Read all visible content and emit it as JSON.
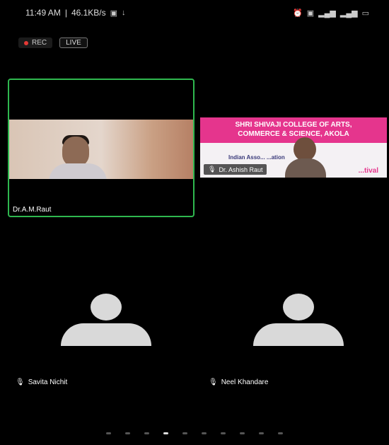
{
  "status_bar": {
    "time": "11:49 AM",
    "speed": "46.1KB/s",
    "right_icons": [
      "alarm-icon",
      "wifi-icon",
      "signal-icon",
      "signal-icon",
      "battery-icon"
    ]
  },
  "topbar": {
    "rec_label": "REC",
    "live_label": "LIVE"
  },
  "main_tile": {
    "name": "Dr.A.M.Raut"
  },
  "share_tile": {
    "banner_line1": "SHRI SHIVAJI COLLEGE OF ARTS,",
    "banner_line2": "COMMERCE & SCIENCE, AKOLA",
    "subtitle": "Indian Asso... ...ation",
    "highlight": "...tival",
    "presenter_name": "Dr. Ashish Raut"
  },
  "participants": [
    {
      "name": "Savita Nichit"
    },
    {
      "name": "Neel Khandare"
    }
  ],
  "pagination": {
    "total_pages": 10,
    "active_page": 4
  }
}
